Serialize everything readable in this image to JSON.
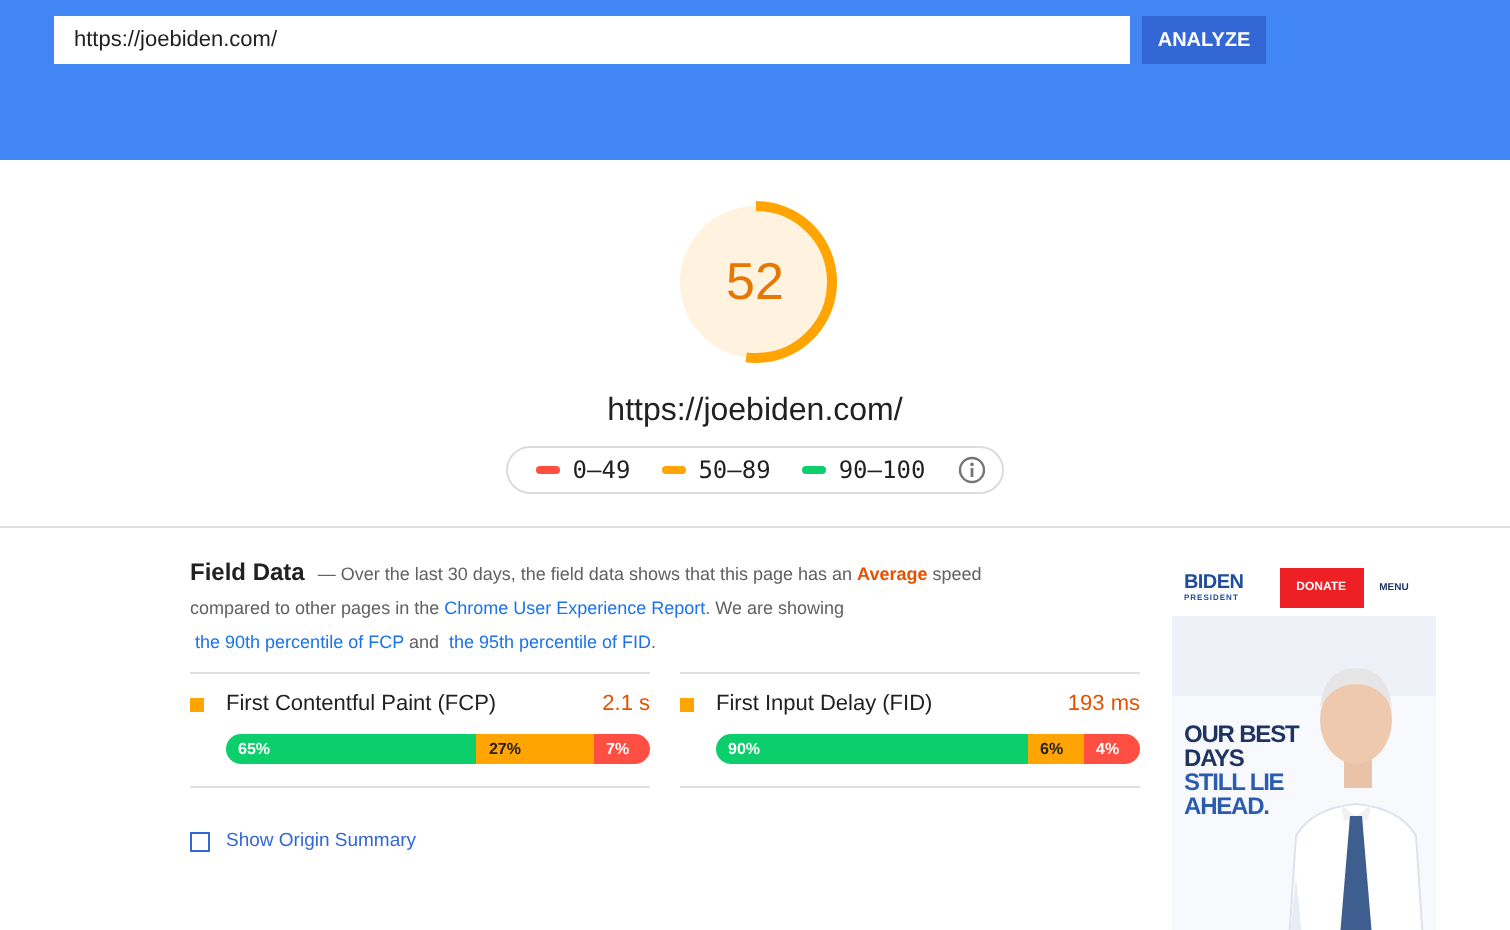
{
  "search": {
    "value": "https://joebiden.com/",
    "button": "ANALYZE"
  },
  "score": {
    "value": "52",
    "level": 0.52,
    "url": "https://joebiden.com/"
  },
  "legend": {
    "items": [
      {
        "label": "0–49",
        "color": "#ff4e42"
      },
      {
        "label": "50–89",
        "color": "#ffa400"
      },
      {
        "label": "90–100",
        "color": "#0cce6b"
      }
    ]
  },
  "field_data": {
    "description": [
      {
        "kind": "heading",
        "text": "Field Data"
      },
      {
        "kind": "text",
        "text": " — Over the last 30 days, the field data shows that this page has an "
      },
      {
        "kind": "rating",
        "text": "Average"
      },
      {
        "kind": "text",
        "text": " speed compared to other pages in the "
      },
      {
        "kind": "link",
        "text": "Chrome User Experience Report"
      },
      {
        "kind": "text",
        "text": ". We are showing "
      },
      {
        "kind": "link",
        "text": "the 90th percentile of"
      },
      {
        "kind": "link",
        "text": "FCP"
      },
      {
        "kind": "text",
        "text": " and "
      },
      {
        "kind": "link",
        "text": "the 95th percentile of FID"
      },
      {
        "kind": "text",
        "text": "."
      }
    ],
    "metrics": [
      {
        "name": "First Contentful Paint (FCP)",
        "value": "2.1 s",
        "color": "#ffa400",
        "segments": [
          {
            "label": "65%",
            "color": "#0cce6b"
          },
          {
            "label": "27%",
            "color": "#ffa400"
          },
          {
            "label": "7%",
            "color": "#ff4e42"
          }
        ]
      },
      {
        "name": "First Input Delay (FID)",
        "value": "193 ms",
        "color": "#ffa400",
        "segments": [
          {
            "label": "90%",
            "color": "#0cce6b"
          },
          {
            "label": "6%",
            "color": "#ffa400"
          },
          {
            "label": "4%",
            "color": "#ff4e42"
          }
        ]
      }
    ],
    "origin_summary": {
      "label": "Show Origin Summary",
      "checked": false
    }
  },
  "thumbnail": {
    "logo": "BIDEN",
    "logo_sub": "PRESIDENT",
    "donate": "DONATE",
    "menu": "MENU",
    "headline": [
      "OUR BEST",
      "DAYS",
      "STILL LIE",
      "AHEAD."
    ]
  }
}
